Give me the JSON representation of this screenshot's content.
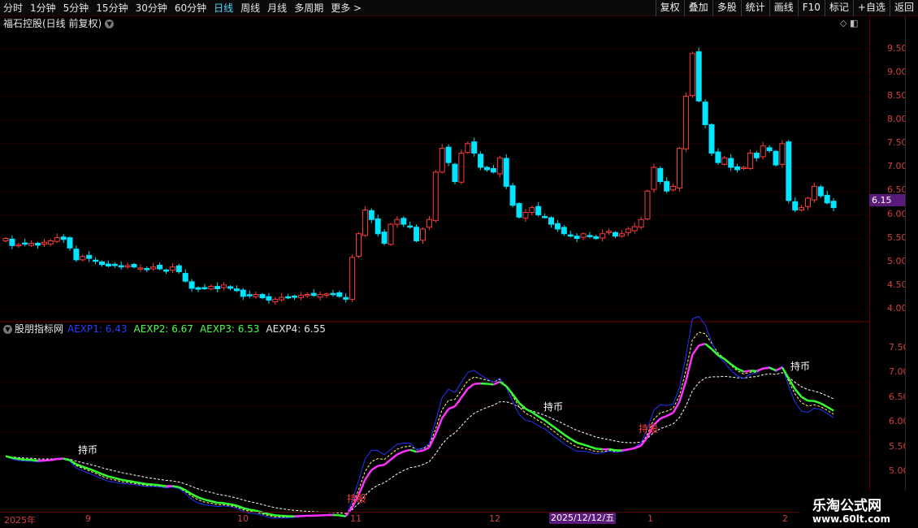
{
  "toolbar": {
    "periods": [
      "分时",
      "1分钟",
      "5分钟",
      "15分钟",
      "30分钟",
      "60分钟",
      "日线",
      "周线",
      "月线",
      "多周期",
      "更多 >"
    ],
    "active_period_index": 6,
    "buttons": [
      "复权",
      "叠加",
      "多股",
      "统计",
      "画线",
      "F10",
      "标记",
      "+自选",
      "返回"
    ]
  },
  "main_chart": {
    "title": "福石控股(日线 前复权)",
    "current_price": "6.15",
    "y_ticks": [
      "9.50",
      "9.00",
      "8.50",
      "8.00",
      "7.50",
      "7.00",
      "6.50",
      "6.00",
      "5.50",
      "5.00",
      "4.50",
      "4.00"
    ]
  },
  "indicator": {
    "name": "股朋指标网",
    "aexp1": "AEXP1: 6.43",
    "aexp2": "AEXP2: 6.67",
    "aexp3": "AEXP3: 6.53",
    "aexp4": "AEXP4: 6.55",
    "y_ticks": [
      "7.50",
      "7.00",
      "6.50",
      "6.00",
      "5.50",
      "5.00"
    ],
    "signals": {
      "hold_coin_1": "持币",
      "hold_coin_2": "持币",
      "hold_coin_3": "持币",
      "hold_stock_1": "持股",
      "hold_stock_2": "持股"
    }
  },
  "time_axis": {
    "labels": [
      "2025年",
      "9",
      "10",
      "11",
      "12",
      "1",
      "2"
    ],
    "cursor_date": "2025/12/12/五"
  },
  "watermark": {
    "title": "乐淘公式网",
    "url": "www.60lt.com"
  },
  "colors": {
    "up": "#ff3b3b",
    "down": "#00e5ff",
    "aexp1": "#2233ff",
    "aexp2_up": "#ff33ff",
    "aexp2_down": "#33ff33",
    "aexp3": "#ffff66",
    "aexp4": "#ffffff"
  }
}
